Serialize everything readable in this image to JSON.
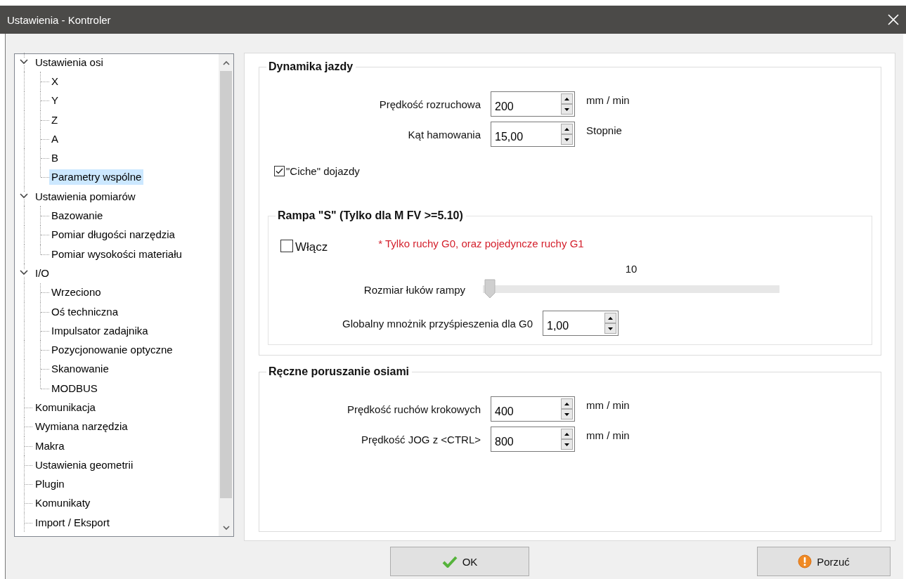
{
  "window": {
    "title": "Ustawienia - Kontroler"
  },
  "tree": [
    {
      "label": "Ustawienia osi",
      "expanded": true,
      "selected": false,
      "children": [
        {
          "label": "X",
          "selected": false
        },
        {
          "label": "Y",
          "selected": false
        },
        {
          "label": "Z",
          "selected": false
        },
        {
          "label": "A",
          "selected": false
        },
        {
          "label": "B",
          "selected": false
        },
        {
          "label": "Parametry wspólne",
          "selected": true
        }
      ]
    },
    {
      "label": "Ustawienia pomiarów",
      "expanded": true,
      "selected": false,
      "children": [
        {
          "label": "Bazowanie",
          "selected": false
        },
        {
          "label": "Pomiar długości narzędzia",
          "selected": false
        },
        {
          "label": "Pomiar wysokości materiału",
          "selected": false
        }
      ]
    },
    {
      "label": "I/O",
      "expanded": true,
      "selected": false,
      "children": [
        {
          "label": "Wrzeciono",
          "selected": false
        },
        {
          "label": "Oś techniczna",
          "selected": false
        },
        {
          "label": "Impulsator zadajnika",
          "selected": false
        },
        {
          "label": "Pozycjonowanie optyczne",
          "selected": false
        },
        {
          "label": "Skanowanie",
          "selected": false
        },
        {
          "label": "MODBUS",
          "selected": false
        }
      ]
    },
    {
      "label": "Komunikacja",
      "selected": false
    },
    {
      "label": "Wymiana narzędzia",
      "selected": false
    },
    {
      "label": "Makra",
      "selected": false
    },
    {
      "label": "Ustawienia geometrii",
      "selected": false
    },
    {
      "label": "Plugin",
      "selected": false
    },
    {
      "label": "Komunikaty",
      "selected": false
    },
    {
      "label": "Import / Eksport",
      "selected": false
    }
  ],
  "sections": [
    {
      "title": "Dynamika jazdy",
      "items": [
        {
          "kind": "spin",
          "label": "Prędkość rozruchowa",
          "value": "200",
          "unit": "mm / min"
        },
        {
          "kind": "spin",
          "label": "Kąt hamowania",
          "value": "15,00",
          "unit": "Stopnie"
        },
        {
          "kind": "checkbox",
          "label": "\"Ciche\" dojazdy",
          "checked": true
        },
        {
          "kind": "group",
          "title": "Rampa \"S\" (Tylko dla M FV >=5.10)",
          "items": [
            {
              "kind": "checkbox",
              "label": "Włącz",
              "checked": false,
              "note": "* Tylko ruchy G0, oraz pojedyncze ruchy G1"
            },
            {
              "kind": "slider",
              "label": "Rozmiar łuków rampy",
              "reading": "10",
              "level": 0
            },
            {
              "kind": "spin",
              "label": "Globalny mnożnik przyśpieszenia dla G0",
              "value": "1,00"
            }
          ]
        }
      ]
    },
    {
      "title": "Ręczne poruszanie osiami",
      "items": [
        {
          "kind": "spin",
          "label": "Prędkość ruchów krokowych",
          "value": "400",
          "unit": "mm / min"
        },
        {
          "kind": "spin",
          "label": "Prędkość  JOG z <CTRL>",
          "value": "800",
          "unit": "mm / min"
        }
      ]
    }
  ],
  "buttons": [
    {
      "kind": "ok",
      "label": "OK"
    },
    {
      "kind": "cancel",
      "label": "Porzuć"
    }
  ]
}
